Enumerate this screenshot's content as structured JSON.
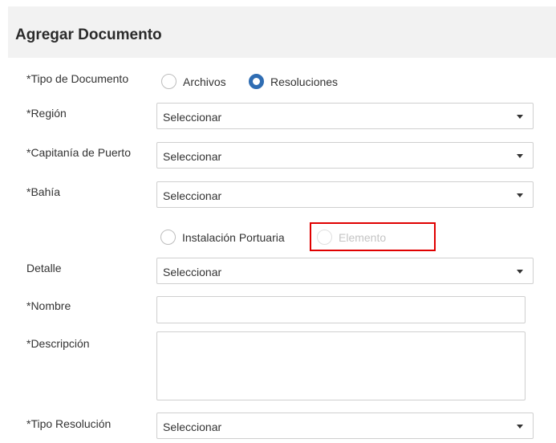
{
  "header": {
    "title": "Agregar Documento"
  },
  "tipo_documento": {
    "label": "*Tipo de Documento",
    "options": [
      "Archivos",
      "Resoluciones"
    ],
    "selected": "Resoluciones"
  },
  "region": {
    "label": "*Región",
    "value": "Seleccionar"
  },
  "capitania": {
    "label": "*Capitanía de Puerto",
    "value": "Seleccionar"
  },
  "bahia": {
    "label": "*Bahía",
    "value": "Seleccionar"
  },
  "subtipo": {
    "options": [
      "Instalación Portuaria",
      "Elemento"
    ],
    "disabled": [
      "Elemento"
    ]
  },
  "detalle": {
    "label": "Detalle",
    "value": "Seleccionar"
  },
  "nombre": {
    "label": "*Nombre",
    "value": ""
  },
  "descripcion": {
    "label": "*Descripción",
    "value": ""
  },
  "tipo_resolucion": {
    "label": "*Tipo Resolución",
    "value": "Seleccionar"
  },
  "colors": {
    "accent": "#2f6db3",
    "highlight": "#e00000",
    "header_bg": "#f2f2f2"
  }
}
